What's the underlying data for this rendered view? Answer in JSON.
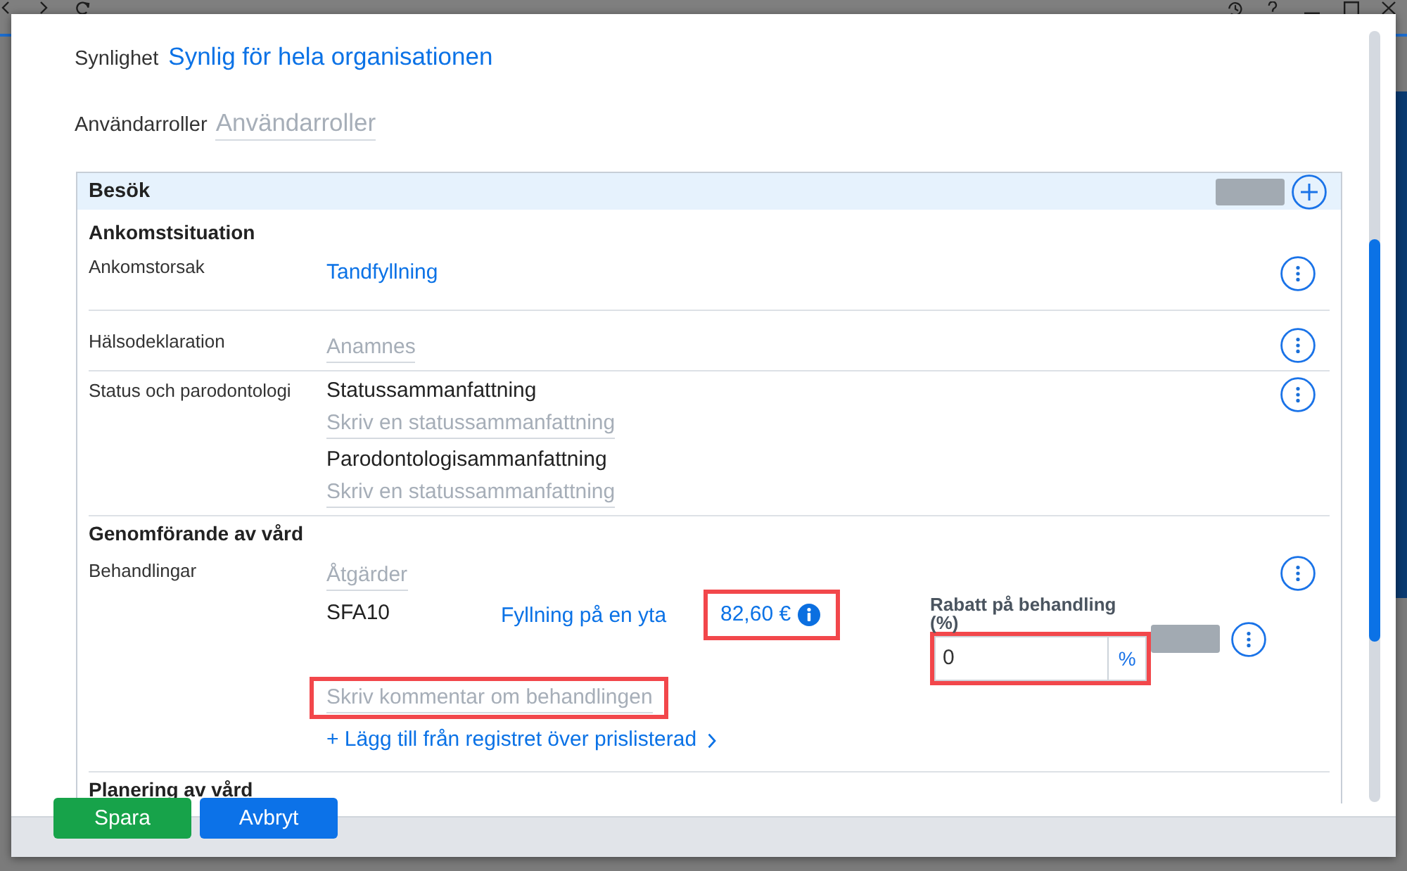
{
  "visibility": {
    "label": "Synlighet",
    "value": "Synlig för hela organisationen"
  },
  "user_roles": {
    "label": "Användarroller",
    "placeholder": "Användarroller"
  },
  "panel": {
    "title": "Besök",
    "sections": [
      {
        "title": "Ankomstsituation",
        "rows": [
          {
            "kind": "link",
            "label": "Ankomstorsak",
            "value": "Tandfyllning"
          },
          {
            "kind": "field",
            "label": "Hälsodeklaration",
            "placeholder": "Anamnes"
          },
          {
            "kind": "summaries",
            "label": "Status och parodontologi",
            "items": [
              {
                "title": "Statussammanfattning",
                "placeholder": "Skriv en statussammanfattning"
              },
              {
                "title": "Parodontologisammanfattning",
                "placeholder": "Skriv en statussammanfattning"
              }
            ]
          }
        ]
      },
      {
        "title": "Genomförande av vård",
        "rows": [
          {
            "kind": "treatments",
            "label": "Behandlingar",
            "placeholder": "Åtgärder",
            "treatments": [
              {
                "code": "SFA10",
                "name": "Fyllning på en yta",
                "price": "82,60 €",
                "price_highlighted": true,
                "discount": {
                  "label": "Rabatt på behandling (%)",
                  "value": "0",
                  "unit": "%",
                  "highlighted": true
                },
                "comment": {
                  "placeholder": "Skriv kommentar om behandlingen",
                  "highlighted": true
                }
              }
            ],
            "add_link": "+ Lägg till från registret över prislisterad"
          }
        ]
      },
      {
        "title": "Planering av vård"
      }
    ]
  },
  "buttons": [
    {
      "kind": "primary",
      "label": "Spara"
    },
    {
      "kind": "secondary",
      "label": "Avbryt"
    }
  ]
}
